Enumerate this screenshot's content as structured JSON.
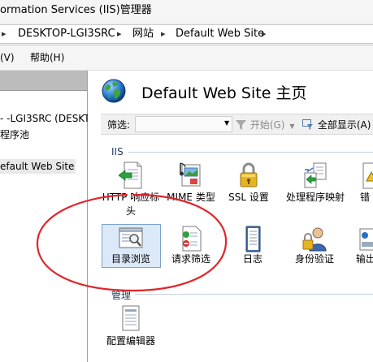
{
  "window": {
    "title": "ormation Services (IIS)管理器"
  },
  "address": {
    "segments": [
      "DESKTOP-LGI3SRC",
      "网站",
      "Default Web Site"
    ],
    "separator": "▸"
  },
  "menu": {
    "items": [
      "(V)",
      "帮助(H)"
    ]
  },
  "tree": {
    "items": [
      "- -LGI3SRC (DESKT",
      "程序池",
      "efault Web Site"
    ]
  },
  "main": {
    "title": "Default Web Site 主页",
    "filter": {
      "label": "筛选:",
      "value": "",
      "start": "开始(G)",
      "show_all": "全部显示(A)"
    },
    "sections": [
      {
        "name": "IIS",
        "icons": [
          {
            "label": "HTTP 响应标头",
            "icon": "http-response-headers-icon"
          },
          {
            "label": "MIME 类型",
            "icon": "mime-types-icon"
          },
          {
            "label": "SSL 设置",
            "icon": "ssl-settings-icon"
          },
          {
            "label": "处理程序映射",
            "icon": "handler-mappings-icon"
          },
          {
            "label": "错",
            "icon": "error-pages-icon"
          },
          {
            "label": "目录浏览",
            "icon": "directory-browsing-icon"
          },
          {
            "label": "请求筛选",
            "icon": "request-filtering-icon"
          },
          {
            "label": "日志",
            "icon": "logging-icon"
          },
          {
            "label": "身份验证",
            "icon": "authentication-icon"
          },
          {
            "label": "输出",
            "icon": "output-caching-icon"
          }
        ]
      },
      {
        "name": "管理",
        "icons": [
          {
            "label": "配置编辑器",
            "icon": "configuration-editor-icon"
          }
        ]
      }
    ]
  },
  "colors": {
    "annotation": "#e0262c",
    "selection": "#dce9f8",
    "selection_border": "#7da2ce"
  }
}
